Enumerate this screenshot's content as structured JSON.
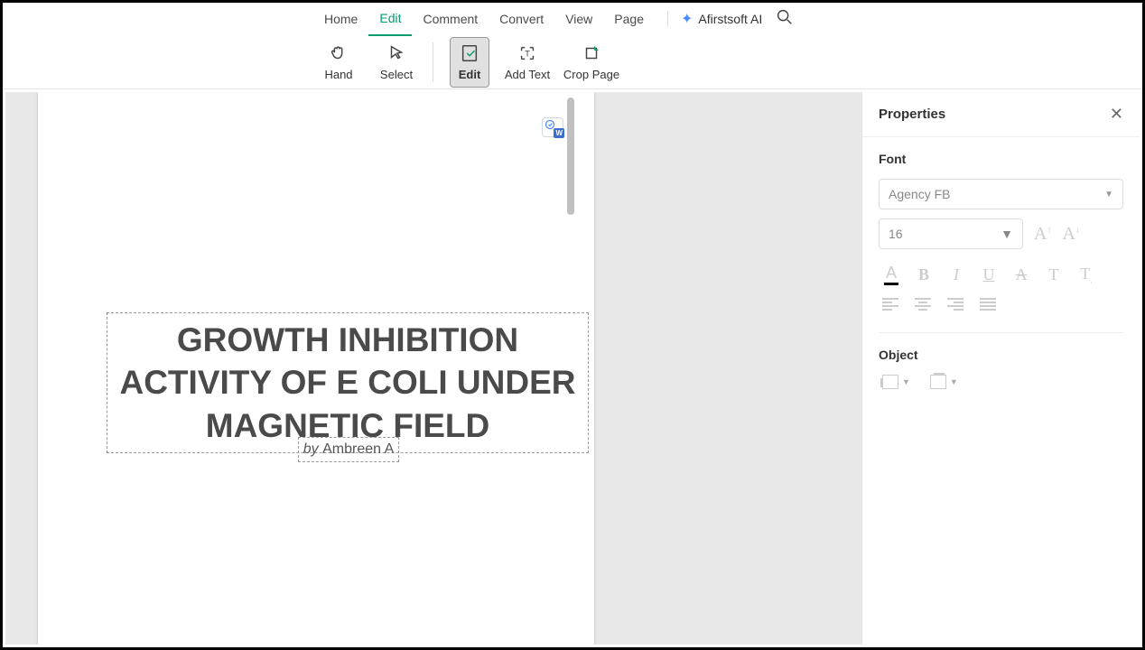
{
  "menu": {
    "home": "Home",
    "edit": "Edit",
    "comment": "Comment",
    "convert": "Convert",
    "view": "View",
    "page": "Page"
  },
  "ai_label": "Afirstsoft AI",
  "tools": {
    "hand": "Hand",
    "select": "Select",
    "edit": "Edit",
    "add_text": "Add Text",
    "crop_page": "Crop Page"
  },
  "document": {
    "title": "GROWTH INHIBITION ACTIVITY OF E COLI UNDER MAGNETIC FIELD",
    "by_prefix": "by ",
    "author": "Ambreen A"
  },
  "panel": {
    "title": "Properties",
    "font_heading": "Font",
    "font_family": "Agency FB",
    "font_size": "16",
    "object_heading": "Object"
  }
}
